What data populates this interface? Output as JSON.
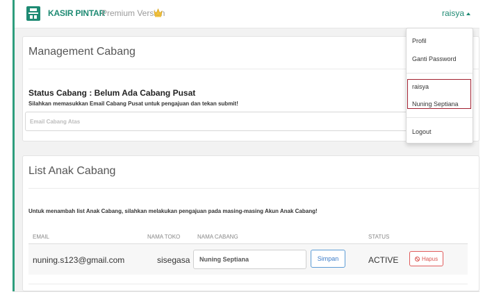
{
  "header": {
    "brand": "KASIR PINTAR",
    "version": "Premium Version",
    "user": "raisya"
  },
  "dropdown": {
    "items": [
      "Profil",
      "Ganti Password"
    ],
    "branches": [
      "raisya",
      "Nuning Septiana"
    ],
    "logout": "Logout"
  },
  "management": {
    "title": "Management Cabang",
    "status": "Status Cabang : Belum Ada Cabang Pusat",
    "instruction": "Silahkan memasukkan Email Cabang Pusat untuk pengajuan dan tekan submit!",
    "email_placeholder": "Email Cabang Atas"
  },
  "list": {
    "title": "List Anak Cabang",
    "info": "Untuk menambah list Anak Cabang, silahkan melakukan pengajuan pada masing-masing Akun Anak Cabang!",
    "columns": [
      "EMAIL",
      "NAMA TOKO",
      "NAMA CABANG",
      "STATUS"
    ],
    "rows": [
      {
        "email": "nuning.s123@gmail.com",
        "toko": "sisegasa",
        "cabang": "Nuning Septiana",
        "save": "Simpan",
        "status": "ACTIVE",
        "delete": "Hapus"
      }
    ]
  },
  "colors": {
    "accent": "#1e8a73",
    "primary_button": "#5b9bd5",
    "danger": "#d9534f",
    "highlight_border": "#a01e2e"
  }
}
